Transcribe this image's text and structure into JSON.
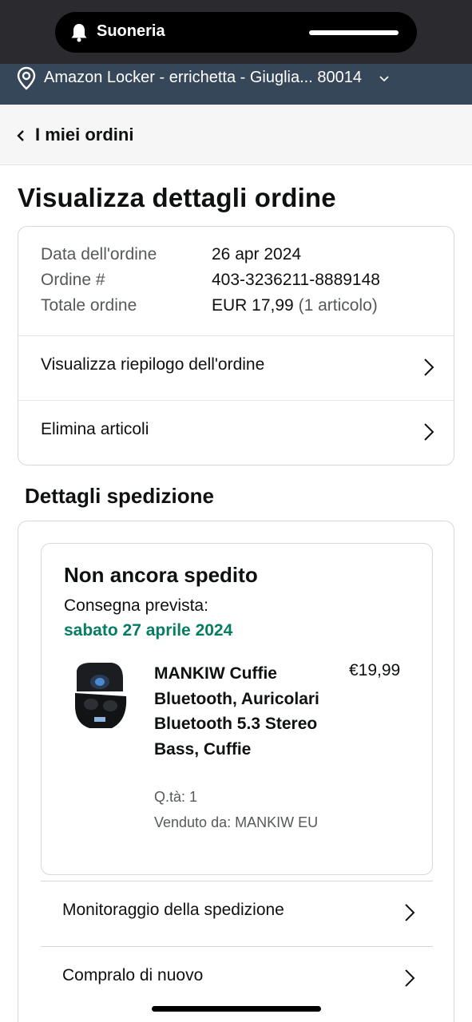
{
  "status_bar": {
    "island_label": "Suoneria"
  },
  "location": {
    "text": "Amazon Locker - errichetta - Giuglia... 80014"
  },
  "back": {
    "label": "I miei ordini"
  },
  "page": {
    "title": "Visualizza dettagli ordine"
  },
  "order_info": {
    "rows": [
      {
        "key": "Data dell'ordine",
        "value": "26 apr 2024"
      },
      {
        "key": "Ordine #",
        "value": "403-3236211-8889148"
      },
      {
        "key": "Totale ordine",
        "value": "EUR 17,99",
        "extra": "(1 articolo)"
      }
    ],
    "links": [
      "Visualizza riepilogo dell'ordine",
      "Elimina articoli"
    ]
  },
  "shipment": {
    "section_title": "Dettagli spedizione",
    "status": "Non ancora spedito",
    "delivery_label": "Consegna prevista:",
    "delivery_date": "sabato 27 aprile 2024",
    "product": {
      "name": "MANKIW Cuffie Bluetooth, Auricolari Bluetooth 5.3 Stereo Bass, Cuffie",
      "price": "€19,99",
      "qty": "Q.tà: 1",
      "seller": "Venduto da: MANKIW EU"
    },
    "links": [
      "Monitoraggio della spedizione",
      "Compralo di nuovo"
    ]
  },
  "colors": {
    "status_bar": "#2b2b2f",
    "location_bar": "#37475a",
    "delivery_green": "#067d62"
  }
}
